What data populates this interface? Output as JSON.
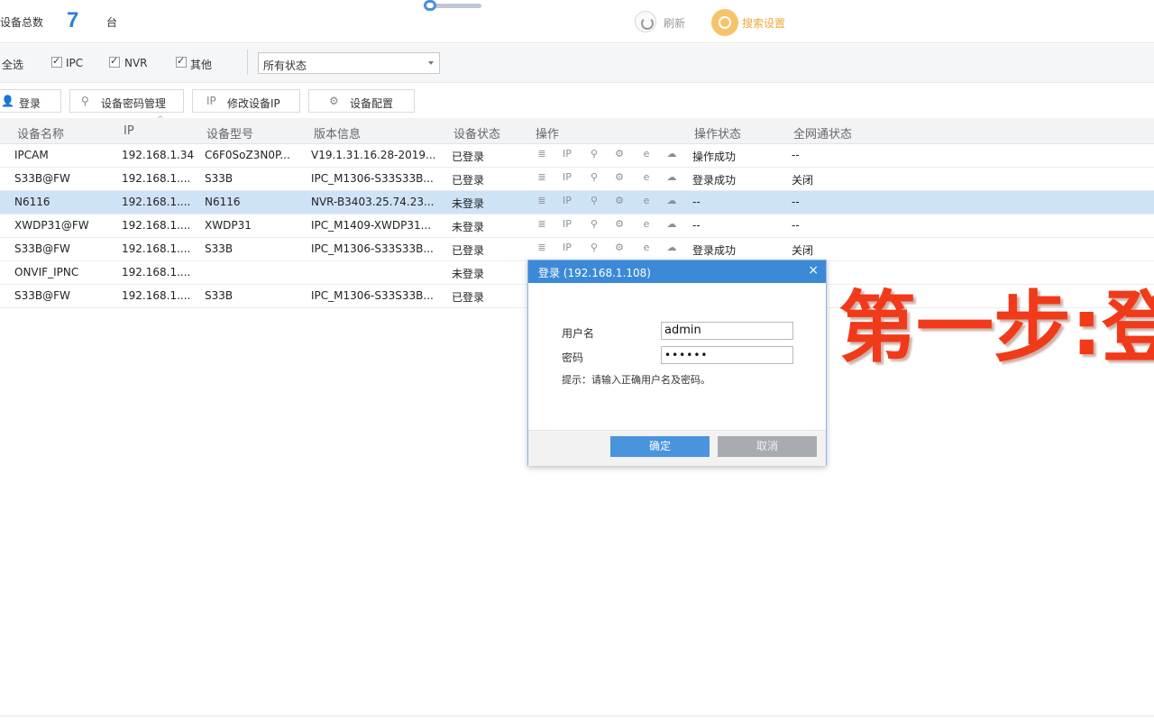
{
  "header": {
    "device_total_label": "设备总数",
    "device_count": "7",
    "device_unit": "台",
    "refresh_label": "刷新",
    "search_settings_label": "搜索设置"
  },
  "filter": {
    "select_all": "全选",
    "ipc": "IPC",
    "nvr": "NVR",
    "other": "其他",
    "status_select_value": "所有状态"
  },
  "toolbar": {
    "login": "登录",
    "password_manage": "设备密码管理",
    "modify_ip_icon": "IP",
    "modify_ip": "修改设备IP",
    "device_config": "设备配置"
  },
  "table": {
    "headers": [
      "设备名称",
      "IP",
      "设备型号",
      "版本信息",
      "设备状态",
      "操作",
      "操作状态",
      "全网通状态"
    ],
    "rows": [
      {
        "name": "IPCAM",
        "ip": "192.168.1.34",
        "model": "C6F0SoZ3N0P...",
        "version": "V19.1.31.16.28-2019...",
        "status": "已登录",
        "op_status": "操作成功",
        "net_status": "--"
      },
      {
        "name": "S33B@FW",
        "ip": "192.168.1....",
        "model": "S33B",
        "version": "IPC_M1306-S33S33B...",
        "status": "已登录",
        "op_status": "登录成功",
        "net_status": "关闭"
      },
      {
        "name": "N6116",
        "ip": "192.168.1....",
        "model": "N6116",
        "version": "NVR-B3403.25.74.23...",
        "status": "未登录",
        "op_status": "--",
        "net_status": "--"
      },
      {
        "name": "XWDP31@FW",
        "ip": "192.168.1....",
        "model": "XWDP31",
        "version": "IPC_M1409-XWDP31...",
        "status": "未登录",
        "op_status": "--",
        "net_status": "--"
      },
      {
        "name": "S33B@FW",
        "ip": "192.168.1....",
        "model": "S33B",
        "version": "IPC_M1306-S33S33B...",
        "status": "已登录",
        "op_status": "登录成功",
        "net_status": "关闭"
      },
      {
        "name": "ONVIF_IPNC",
        "ip": "192.168.1....",
        "model": "",
        "version": "",
        "status": "未登录",
        "op_status": "",
        "net_status": ""
      },
      {
        "name": "S33B@FW",
        "ip": "192.168.1....",
        "model": "S33B",
        "version": "IPC_M1306-S33S33B...",
        "status": "已登录",
        "op_status": "",
        "net_status": ""
      }
    ],
    "op_icons": [
      "≣",
      "IP",
      "⚲",
      "⚙",
      "e",
      "☁"
    ]
  },
  "dialog": {
    "title": "登录 (192.168.1.108)",
    "close": "×",
    "username_label": "用户名",
    "username_value": "admin",
    "password_label": "密码",
    "password_value": "••••••",
    "tip": "提示：请输入正确用户名及密码。",
    "ok": "确定",
    "cancel": "取消"
  },
  "overlay": {
    "text": "第一步:登"
  }
}
